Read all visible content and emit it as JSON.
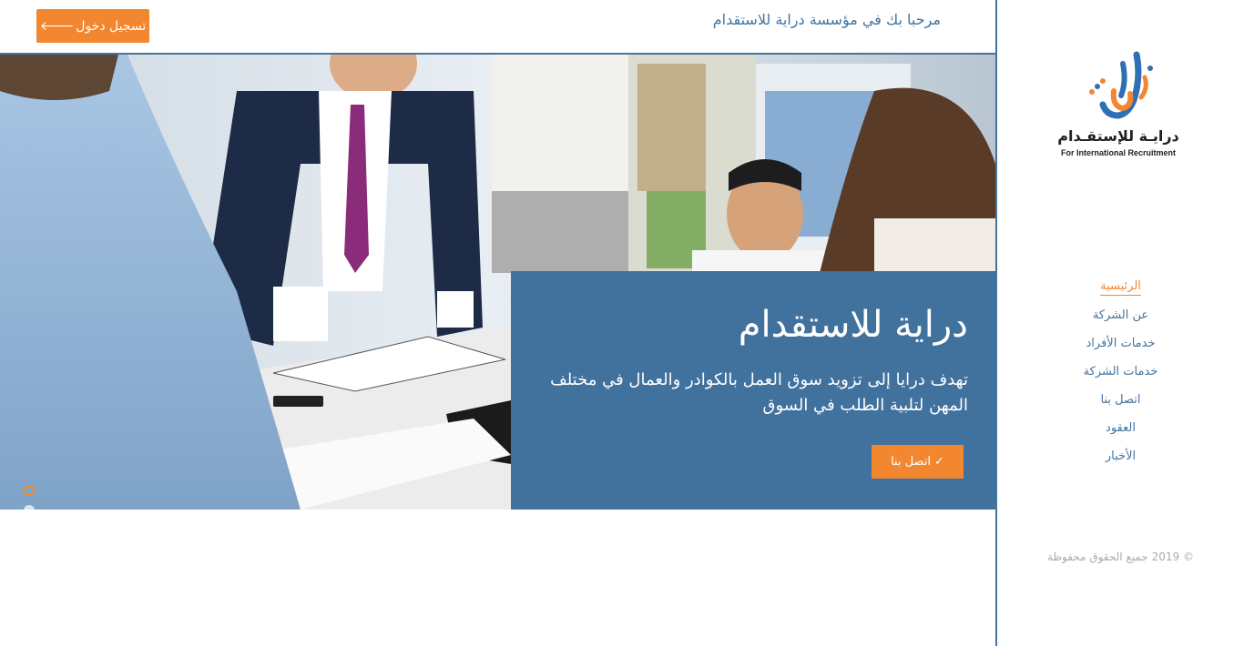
{
  "header": {
    "login_label": "تسجيل دخول",
    "login_icon": "arrow-left-icon",
    "welcome_text": "مرحبا بك في مؤسسة دراية للاستقدام"
  },
  "sidebar": {
    "logo": {
      "name_ar": "درايـة للإستقـدام",
      "name_en": "For International Recruitment"
    },
    "nav_items": [
      {
        "label": "الرئيسية",
        "active": true
      },
      {
        "label": "عن الشركة",
        "active": false
      },
      {
        "label": "خدمات الأفراد",
        "active": false
      },
      {
        "label": "خدمات الشركة",
        "active": false
      },
      {
        "label": "اتصل بنا",
        "active": false
      },
      {
        "label": "العقود",
        "active": false
      },
      {
        "label": "الأخبار",
        "active": false
      }
    ],
    "copyright": "© 2019 جميع الحقوق محفوظة"
  },
  "hero": {
    "title": "دراية للاستقدام",
    "description": "تهدف درايا إلى تزويد سوق العمل بالكوادر والعمال في مختلف المهن لتلبية الطلب في السوق",
    "cta_label": "اتصل بنا",
    "cta_icon": "check-icon",
    "slides_count": 3,
    "active_slide": 0
  },
  "colors": {
    "accent": "#f28730",
    "brand_blue": "#41719d"
  }
}
